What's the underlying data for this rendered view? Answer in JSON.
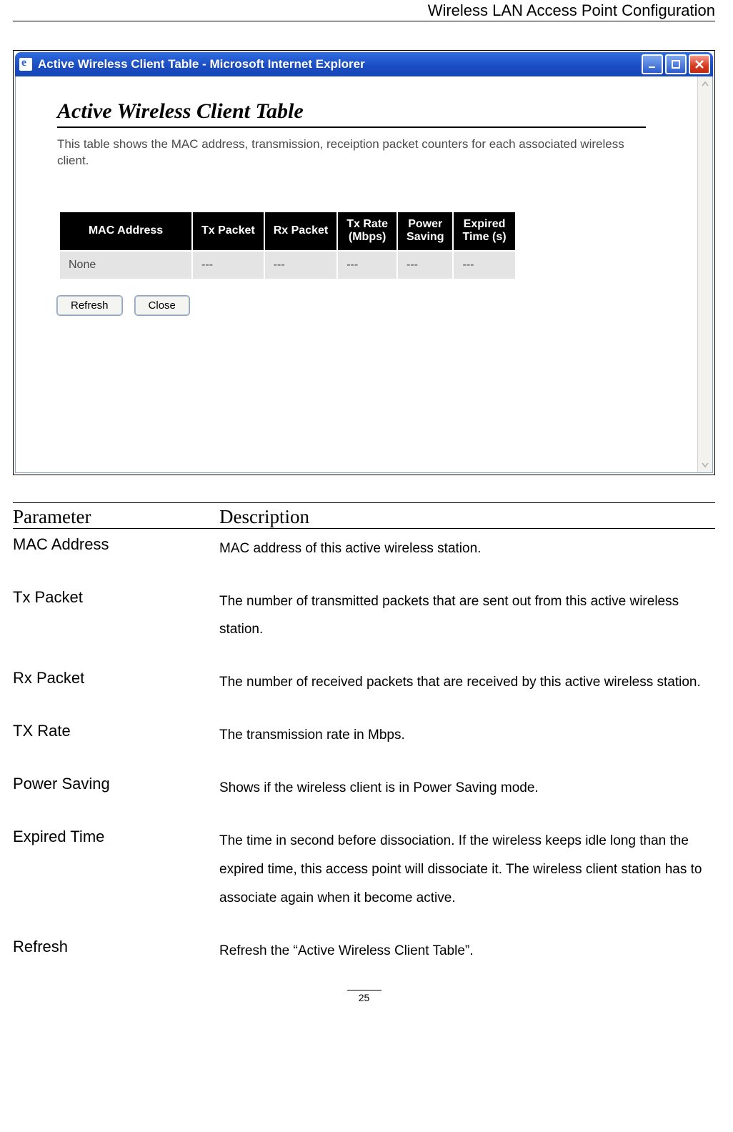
{
  "header": {
    "running_head": "Wireless LAN Access Point Configuration"
  },
  "window": {
    "title": "Active Wireless Client Table - Microsoft Internet Explorer",
    "content_title": "Active Wireless Client Table",
    "content_desc": "This table shows the MAC address, transmission, receiption packet counters for each associated wireless client.",
    "columns": [
      "MAC Address",
      "Tx Packet",
      "Rx Packet",
      "Tx Rate (Mbps)",
      "Power Saving",
      "Expired Time (s)"
    ],
    "row": [
      "None",
      "---",
      "---",
      "---",
      "---",
      "---"
    ],
    "refresh_label": "Refresh",
    "close_label": "Close"
  },
  "param_table": {
    "h1": "Parameter",
    "h2": "Description",
    "rows": [
      {
        "p": "MAC Address",
        "d": "MAC address of this active wireless station."
      },
      {
        "p": "Tx Packet",
        "d": "The number of transmitted packets that are sent out from this active wireless station."
      },
      {
        "p": "Rx Packet",
        "d": "The number of received packets that are received by this active wireless station."
      },
      {
        "p": "TX Rate",
        "d": "The transmission rate in Mbps."
      },
      {
        "p": "Power Saving",
        "d": "Shows if the wireless client is in Power Saving mode."
      },
      {
        "p": "Expired Time",
        "d": "The time in second before dissociation. If the wireless keeps idle long than the expired time, this access point will dissociate it. The wireless client station has to associate again when it become active."
      },
      {
        "p": "Refresh",
        "d": "Refresh the “Active Wireless Client Table”."
      }
    ]
  },
  "page_number": "25"
}
